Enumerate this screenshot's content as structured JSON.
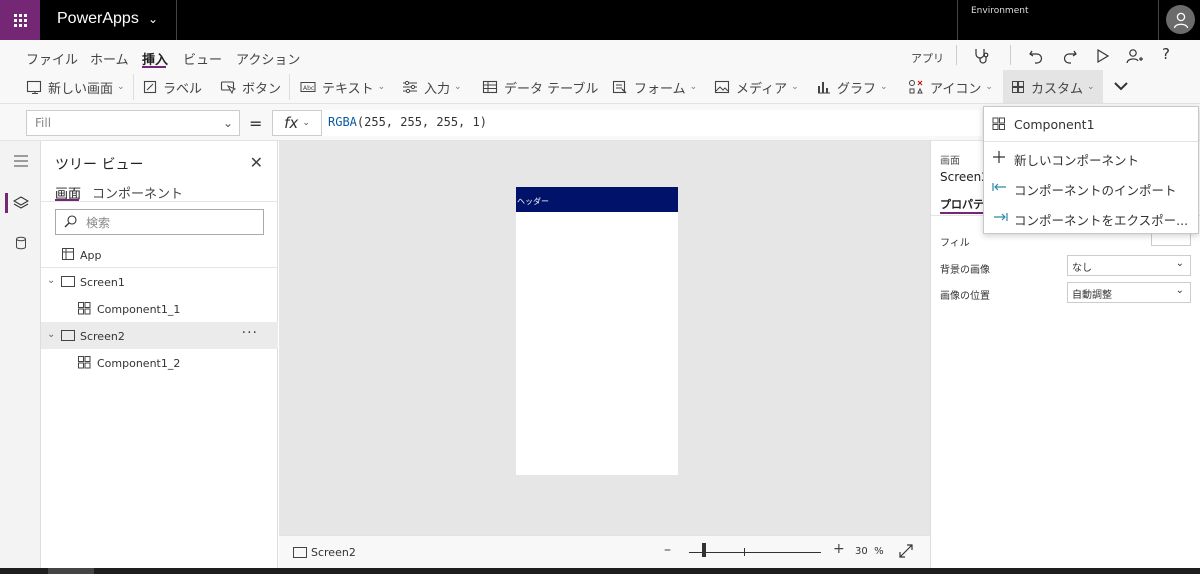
{
  "header": {
    "app_title": "PowerApps",
    "environment_label": "Environment"
  },
  "menu": {
    "items": [
      "ファイル",
      "ホーム",
      "挿入",
      "ビュー",
      "アクション"
    ],
    "active": "挿入",
    "app_label": "アプリ"
  },
  "ribbon": {
    "new_screen": "新しい画面",
    "label": "ラベル",
    "button": "ボタン",
    "text": "テキスト",
    "input": "入力",
    "data_table": "データ テーブル",
    "form": "フォーム",
    "media": "メディア",
    "chart": "グラフ",
    "icons": "アイコン",
    "custom": "カスタム"
  },
  "formula_bar": {
    "property": "Fill",
    "fx": "fx",
    "formula_fn": "RGBA",
    "formula_args": "(255, 255, 255, 1)"
  },
  "tree_view": {
    "title": "ツリー ビュー",
    "tabs": [
      "画面",
      "コンポーネント"
    ],
    "search_placeholder": "検索",
    "nodes": [
      "App",
      "Screen1",
      "Component1_1",
      "Screen2",
      "Component1_2"
    ]
  },
  "canvas": {
    "header_label": "ヘッダー",
    "status_screen": "Screen2",
    "zoom_value": "30",
    "zoom_unit": "%"
  },
  "properties": {
    "type_label": "画面",
    "name": "Screen2",
    "tab": "プロパティ",
    "rows": [
      {
        "label": "フィル",
        "value": ""
      },
      {
        "label": "背景の画像",
        "value": "なし"
      },
      {
        "label": "画像の位置",
        "value": "自動調整"
      }
    ]
  },
  "custom_dropdown": {
    "items": [
      "Component1",
      "新しいコンポーネント",
      "コンポーネントのインポート",
      "コンポーネントをエクスポー..."
    ]
  },
  "colors": {
    "brand": "#742774",
    "screen_header": "#00126a",
    "topbar": "#000000"
  }
}
